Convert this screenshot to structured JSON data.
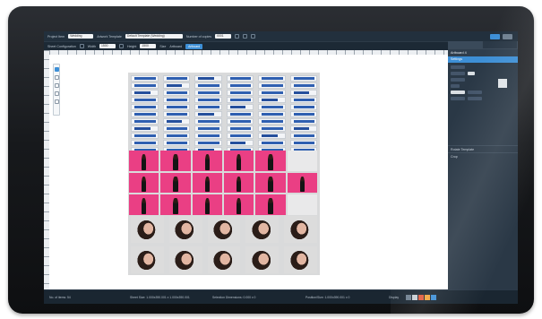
{
  "toolbar": {
    "project_label": "Project Item",
    "project_value": "Wedding",
    "template_label": "Artwork Template",
    "template_value": "Default Template (Wedding)",
    "quantity_label": "Number of copies",
    "quantity_value": "0001",
    "sheet_label": "Sheet Configuration",
    "width_label": "Width",
    "width_value": "1500",
    "height_label": "Height",
    "height_value": "1500",
    "unit_label": "Size",
    "apply_label": "Artboard",
    "apply_button": "Artboard"
  },
  "panel": {
    "header": "Artboard 4",
    "section": "Settings",
    "row_a": "Rotate Template",
    "row_b": "Crop"
  },
  "status": {
    "zoom": "No. of items: 54",
    "size": "Sheet Size: 1.000x390.001 x 1.000x390.001",
    "selection": "Selection Dimensions: 0.000 x 0",
    "position": "Position/Size: 1.000x390.001 x 0",
    "display_label": "Display"
  },
  "colors": {
    "accent": "#3d8fd6",
    "pink_bg": "#ea3f84",
    "blue_card": "#2f5fb0",
    "toolbar_bg": "#22303d"
  },
  "icons": [
    "undo-icon",
    "redo-icon",
    "zoom-icon",
    "select-tool-icon",
    "move-tool-icon",
    "crop-tool-icon",
    "hand-tool-icon",
    "grid-view-icon"
  ],
  "swatch_colors": [
    "#6f8090",
    "#c7cdd3",
    "#e05a3c",
    "#f2a33a",
    "#3d8fd6"
  ]
}
